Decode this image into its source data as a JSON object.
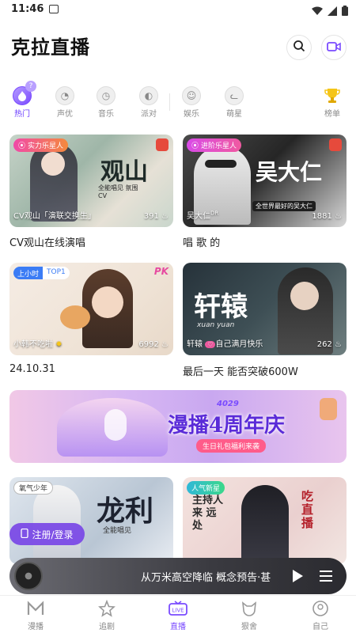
{
  "status_bar": {
    "time": "11:46"
  },
  "header": {
    "title": "克拉直播"
  },
  "categories": [
    {
      "label": "热门",
      "icon": "flame-icon",
      "active": true
    },
    {
      "label": "声优",
      "icon": "voice-icon"
    },
    {
      "label": "音乐",
      "icon": "music-icon"
    },
    {
      "label": "派对",
      "icon": "party-icon"
    },
    {
      "label": "娱乐",
      "icon": "smile-icon"
    },
    {
      "label": "萌星",
      "icon": "cat-icon"
    },
    {
      "label": "榜单",
      "icon": "trophy-icon"
    }
  ],
  "cards": [
    {
      "badge": "实力乐星人",
      "name": "CV观山「演联交换生」",
      "count": "391",
      "title": "CV观山在线演唱",
      "art_text": "观山",
      "art_sub": "全能唱见 氛围CV"
    },
    {
      "badge": "进阶乐星人",
      "name": "吴大仁",
      "name_sup": "DR",
      "count": "1881",
      "title": "唱 歌 的",
      "art_text": "吴大仁",
      "art_sub": "全世界最好的吴大仁"
    },
    {
      "badge": "上小时",
      "badge2": "TOP1",
      "name": "小韩不吃啦",
      "count": "6992",
      "title": "24.10.31",
      "corner": "PK"
    },
    {
      "badge": "",
      "name": "轩辕",
      "name_mid": "自己",
      "name_tail": "满月快乐",
      "count": "262",
      "title": "最后一天 能否突破600W",
      "art_text": "轩辕",
      "art_sub": "xuan yuan"
    }
  ],
  "banner": {
    "title": "漫播4周年庆",
    "subtitle": "生日礼包福利来袭",
    "tag": "4029"
  },
  "bottom_cards": [
    {
      "badge": "氧气少年",
      "art_text": "龙利",
      "art_sub": "全能唱见"
    },
    {
      "badge": "人气新星",
      "art_text": "吃直播",
      "art_sub": "主持人 来 远 处"
    }
  ],
  "register_button": {
    "label": "注册/登录"
  },
  "player": {
    "text": "从万米高空降临 概念预告·甚"
  },
  "tabs": [
    {
      "label": "漫播",
      "icon": "manbo-icon"
    },
    {
      "label": "追剧",
      "icon": "star-icon"
    },
    {
      "label": "直播",
      "icon": "live-icon",
      "active": true
    },
    {
      "label": "狠舍",
      "icon": "fox-icon"
    },
    {
      "label": "自己",
      "icon": "profile-icon"
    }
  ],
  "colors": {
    "accent": "#7a4bff",
    "text": "#222222"
  }
}
